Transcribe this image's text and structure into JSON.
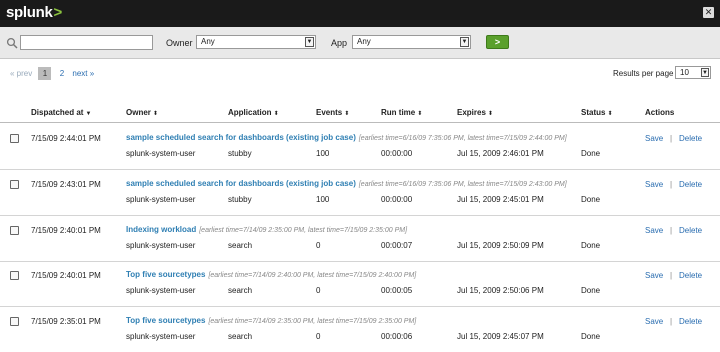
{
  "app": {
    "logo_text": "splunk",
    "logo_chevron": ">",
    "close_glyph": "✕"
  },
  "filters": {
    "search_placeholder": "",
    "owner_label": "Owner",
    "owner_value": "Any",
    "app_label": "App",
    "app_value": "Any",
    "go_glyph": ">"
  },
  "pagination": {
    "prev": "« prev",
    "pages": [
      "1",
      "2"
    ],
    "current": "1",
    "next": "next »",
    "results_per_page_label": "Results per page",
    "results_per_page_value": "10"
  },
  "table": {
    "headers": {
      "dispatched": "Dispatched at",
      "owner": "Owner",
      "application": "Application",
      "events": "Events",
      "runtime": "Run time",
      "expires": "Expires",
      "status": "Status",
      "actions": "Actions"
    },
    "rows": [
      {
        "dispatched": "7/15/09 2:44:01 PM",
        "name": "sample scheduled search for dashboards (existing job case)",
        "meta": "[earliest time=6/16/09 7:35:06 PM, latest time=7/15/09 2:44:00 PM]",
        "owner": "splunk-system-user",
        "app": "stubby",
        "events": "100",
        "runtime": "00:00:00",
        "expires": "Jul 15, 2009 2:46:01 PM",
        "status": "Done"
      },
      {
        "dispatched": "7/15/09 2:43:01 PM",
        "name": "sample scheduled search for dashboards (existing job case)",
        "meta": "[earliest time=6/16/09 7:35:06 PM, latest time=7/15/09 2:43:00 PM]",
        "owner": "splunk-system-user",
        "app": "stubby",
        "events": "100",
        "runtime": "00:00:00",
        "expires": "Jul 15, 2009 2:45:01 PM",
        "status": "Done"
      },
      {
        "dispatched": "7/15/09 2:40:01 PM",
        "name": "Indexing workload",
        "meta": "[earliest time=7/14/09 2:35:00 PM, latest time=7/15/09 2:35:00 PM]",
        "owner": "splunk-system-user",
        "app": "search",
        "events": "0",
        "runtime": "00:00:07",
        "expires": "Jul 15, 2009 2:50:09 PM",
        "status": "Done"
      },
      {
        "dispatched": "7/15/09 2:40:01 PM",
        "name": "Top five sourcetypes",
        "meta": "[earliest time=7/14/09 2:40:00 PM, latest time=7/15/09 2:40:00 PM]",
        "owner": "splunk-system-user",
        "app": "search",
        "events": "0",
        "runtime": "00:00:05",
        "expires": "Jul 15, 2009 2:50:06 PM",
        "status": "Done"
      },
      {
        "dispatched": "7/15/09 2:35:01 PM",
        "name": "Top five sourcetypes",
        "meta": "[earliest time=7/14/09 2:35:00 PM, latest time=7/15/09 2:35:00 PM]",
        "owner": "splunk-system-user",
        "app": "search",
        "events": "0",
        "runtime": "00:00:06",
        "expires": "Jul 15, 2009 2:45:07 PM",
        "status": "Done"
      }
    ],
    "actions": {
      "save": "Save",
      "separator": "|",
      "delete": "Delete"
    }
  },
  "colors": {
    "topbar": "#1a1a1a",
    "brand_accent": "#8cc43f",
    "go_button": "#5aa02c",
    "link": "#2a6db0",
    "search_name": "#2f7fb3"
  }
}
